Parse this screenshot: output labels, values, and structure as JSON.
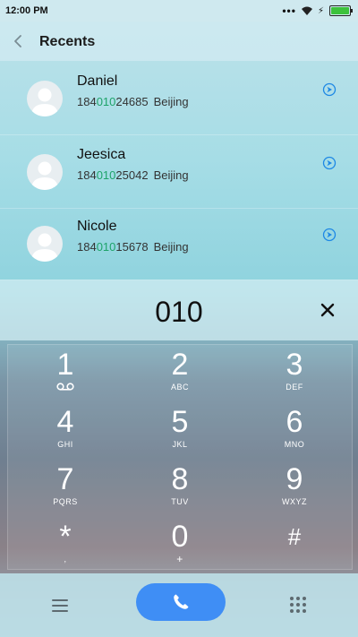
{
  "status": {
    "time": "12:00 PM",
    "more": "•••",
    "charging": "⚡"
  },
  "header": {
    "title": "Recents"
  },
  "contacts": [
    {
      "name": "Daniel",
      "num_pre": "184",
      "num_match": "010",
      "num_post": "24685",
      "location": "Beijing"
    },
    {
      "name": "Jeesica",
      "num_pre": "184",
      "num_match": "010",
      "num_post": "25042",
      "location": "Beijing"
    },
    {
      "name": "Nicole",
      "num_pre": "184",
      "num_match": "010",
      "num_post": "15678",
      "location": "Beijing"
    }
  ],
  "entry": {
    "number": "010"
  },
  "keys": [
    {
      "digit": "1",
      "letters": ""
    },
    {
      "digit": "2",
      "letters": "ABC"
    },
    {
      "digit": "3",
      "letters": "DEF"
    },
    {
      "digit": "4",
      "letters": "GHI"
    },
    {
      "digit": "5",
      "letters": "JKL"
    },
    {
      "digit": "6",
      "letters": "MNO"
    },
    {
      "digit": "7",
      "letters": "PQRS"
    },
    {
      "digit": "8",
      "letters": "TUV"
    },
    {
      "digit": "9",
      "letters": "WXYZ"
    },
    {
      "digit": "*",
      "letters": ","
    },
    {
      "digit": "0",
      "letters": "+"
    },
    {
      "digit": "#",
      "letters": ""
    }
  ],
  "colors": {
    "match": "#1ea36a",
    "call": "#3f8ef5",
    "info": "#1e88e5"
  },
  "icons": {
    "back": "chevron-left-icon",
    "info": "arrow-circle-icon",
    "clear": "close-icon",
    "voicemail": "voicemail-icon",
    "menu": "menu-icon",
    "call": "phone-icon",
    "dialpad": "dialpad-icon"
  }
}
